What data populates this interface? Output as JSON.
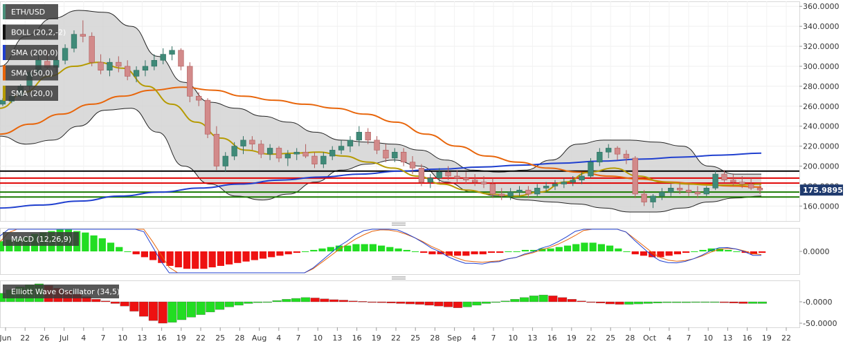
{
  "chart_data": [
    {
      "type": "line",
      "title": "ETH/USD",
      "legend": [
        {
          "label": "ETH/USD",
          "color": "#4a8f7a"
        },
        {
          "label": "BOLL (20,2,-2)",
          "color": "#111111"
        },
        {
          "label": "SMA (200,0)",
          "color": "#1f3fcf"
        },
        {
          "label": "SMA (50,0)",
          "color": "#e8650a"
        },
        {
          "label": "SMA (20,0)",
          "color": "#b59a00"
        }
      ],
      "ylim": [
        145,
        365
      ],
      "y_ticks": [
        "360.0000",
        "340.0000",
        "320.0000",
        "300.0000",
        "280.0000",
        "260.0000",
        "240.0000",
        "220.0000",
        "200.0000",
        "180.0000",
        "160.0000"
      ],
      "last_price": "175.98956",
      "x_ticks": [
        "Jun",
        "22",
        "26",
        "Jul",
        "4",
        "7",
        "10",
        "13",
        "16",
        "19",
        "22",
        "25",
        "28",
        "Aug",
        "4",
        "7",
        "10",
        "13",
        "16",
        "19",
        "22",
        "25",
        "28",
        "Sep",
        "4",
        "7",
        "10",
        "13",
        "16",
        "19",
        "22",
        "25",
        "28",
        "Oct",
        "4",
        "7",
        "10",
        "13",
        "16",
        "19",
        "22"
      ],
      "horizontal_levels": [
        {
          "value": 195,
          "color": "#000000"
        },
        {
          "value": 188,
          "color": "#e00000"
        },
        {
          "value": 183,
          "color": "#e00000"
        },
        {
          "value": 174,
          "color": "#1a7a00"
        },
        {
          "value": 169,
          "color": "#1a7a00"
        }
      ],
      "candles": [
        [
          262,
          268,
          260,
          266
        ],
        [
          265,
          272,
          263,
          270
        ],
        [
          270,
          282,
          268,
          280
        ],
        [
          280,
          296,
          276,
          294
        ],
        [
          294,
          312,
          290,
          306
        ],
        [
          305,
          316,
          296,
          299
        ],
        [
          299,
          310,
          294,
          306
        ],
        [
          306,
          322,
          302,
          318
        ],
        [
          318,
          336,
          314,
          332
        ],
        [
          332,
          346,
          324,
          330
        ],
        [
          330,
          334,
          300,
          304
        ],
        [
          304,
          312,
          292,
          296
        ],
        [
          296,
          308,
          290,
          304
        ],
        [
          304,
          310,
          294,
          300
        ],
        [
          300,
          306,
          286,
          290
        ],
        [
          290,
          300,
          284,
          296
        ],
        [
          296,
          306,
          290,
          300
        ],
        [
          300,
          312,
          296,
          306
        ],
        [
          306,
          318,
          302,
          312
        ],
        [
          312,
          320,
          306,
          316
        ],
        [
          316,
          318,
          296,
          300
        ],
        [
          300,
          304,
          264,
          270
        ],
        [
          270,
          274,
          260,
          266
        ],
        [
          266,
          268,
          228,
          232
        ],
        [
          232,
          240,
          196,
          200
        ],
        [
          200,
          214,
          194,
          210
        ],
        [
          210,
          224,
          206,
          220
        ],
        [
          220,
          230,
          212,
          226
        ],
        [
          226,
          230,
          216,
          222
        ],
        [
          222,
          226,
          208,
          212
        ],
        [
          212,
          222,
          206,
          218
        ],
        [
          218,
          220,
          204,
          208
        ],
        [
          208,
          216,
          200,
          212
        ],
        [
          212,
          218,
          206,
          214
        ],
        [
          214,
          222,
          208,
          210
        ],
        [
          210,
          214,
          198,
          202
        ],
        [
          202,
          214,
          198,
          210
        ],
        [
          210,
          220,
          206,
          216
        ],
        [
          216,
          226,
          212,
          220
        ],
        [
          220,
          230,
          214,
          226
        ],
        [
          226,
          240,
          220,
          234
        ],
        [
          234,
          238,
          222,
          226
        ],
        [
          226,
          230,
          212,
          216
        ],
        [
          216,
          222,
          204,
          208
        ],
        [
          208,
          218,
          204,
          214
        ],
        [
          214,
          218,
          200,
          204
        ],
        [
          204,
          210,
          192,
          198
        ],
        [
          198,
          202,
          180,
          184
        ],
        [
          184,
          192,
          178,
          188
        ],
        [
          188,
          198,
          184,
          194
        ],
        [
          194,
          200,
          186,
          190
        ],
        [
          190,
          196,
          184,
          188
        ],
        [
          188,
          194,
          182,
          186
        ],
        [
          186,
          192,
          180,
          184
        ],
        [
          184,
          190,
          178,
          182
        ],
        [
          182,
          188,
          168,
          172
        ],
        [
          172,
          178,
          166,
          170
        ],
        [
          170,
          178,
          166,
          174
        ],
        [
          174,
          180,
          170,
          176
        ],
        [
          176,
          180,
          168,
          172
        ],
        [
          172,
          182,
          170,
          178
        ],
        [
          178,
          184,
          174,
          180
        ],
        [
          180,
          186,
          176,
          182
        ],
        [
          182,
          188,
          178,
          184
        ],
        [
          184,
          190,
          180,
          186
        ],
        [
          186,
          194,
          182,
          190
        ],
        [
          190,
          208,
          188,
          204
        ],
        [
          204,
          218,
          200,
          214
        ],
        [
          214,
          222,
          208,
          218
        ],
        [
          218,
          220,
          206,
          212
        ],
        [
          212,
          216,
          202,
          208
        ],
        [
          208,
          210,
          168,
          172
        ],
        [
          172,
          176,
          160,
          164
        ],
        [
          164,
          172,
          158,
          170
        ],
        [
          170,
          178,
          166,
          174
        ],
        [
          174,
          182,
          170,
          178
        ],
        [
          178,
          184,
          172,
          176
        ],
        [
          176,
          182,
          170,
          174
        ],
        [
          174,
          180,
          168,
          172
        ],
        [
          172,
          180,
          170,
          178
        ],
        [
          178,
          196,
          176,
          192
        ],
        [
          192,
          196,
          184,
          186
        ],
        [
          186,
          192,
          180,
          184
        ],
        [
          184,
          190,
          178,
          182
        ],
        [
          182,
          188,
          176,
          178
        ],
        [
          178,
          182,
          172,
          176
        ]
      ],
      "series": [
        {
          "name": "SMA (200,0)",
          "values": [
            158,
            161,
            165,
            170,
            174,
            178,
            182,
            186,
            189,
            192,
            195,
            197,
            199,
            201,
            203,
            205,
            207,
            209,
            211,
            213
          ]
        },
        {
          "name": "SMA (50,0)",
          "values": [
            232,
            242,
            252,
            262,
            270,
            276,
            279,
            276,
            270,
            266,
            262,
            258,
            252,
            244,
            232,
            220,
            210,
            204,
            198,
            194,
            190,
            187,
            184,
            182,
            180,
            179
          ]
        },
        {
          "name": "SMA (20,0)",
          "values": [
            258,
            274,
            290,
            300,
            304,
            298,
            280,
            262,
            244,
            228,
            216,
            212,
            213,
            214,
            210,
            204,
            198,
            190,
            182,
            176,
            172,
            170,
            174,
            184,
            194,
            198,
            190,
            184,
            182,
            181,
            181,
            182
          ]
        },
        {
          "name": "BOLL upper",
          "values": [
            300,
            330,
            348,
            356,
            354,
            340,
            310,
            284,
            264,
            258,
            250,
            244,
            234,
            226,
            224,
            222,
            216,
            206,
            196,
            194,
            196,
            206,
            222,
            226,
            226,
            224,
            220,
            200,
            192,
            192
          ]
        },
        {
          "name": "BOLL lower",
          "values": [
            230,
            222,
            226,
            240,
            256,
            258,
            234,
            200,
            182,
            170,
            166,
            172,
            184,
            196,
            202,
            206,
            200,
            184,
            174,
            170,
            166,
            164,
            162,
            158,
            154,
            154,
            158,
            164,
            168,
            170
          ]
        }
      ]
    },
    {
      "type": "bar",
      "title": "MACD (12,26,9)",
      "y_ticks": [
        "0.0000"
      ],
      "values": [
        7,
        8,
        9,
        10,
        12,
        13,
        14,
        15,
        15,
        14,
        13,
        11,
        9,
        6,
        3,
        0,
        -2,
        -4,
        -6,
        -8,
        -10,
        -11,
        -12,
        -12,
        -12,
        -11,
        -10,
        -9,
        -8,
        -7,
        -6,
        -5,
        -4,
        -3,
        -2,
        -1,
        0,
        1,
        2,
        3,
        4,
        4,
        5,
        5,
        5,
        4,
        3,
        2,
        1,
        0,
        -1,
        -2,
        -2,
        -3,
        -3,
        -3,
        -2,
        -2,
        -1,
        -1,
        0,
        0,
        1,
        1,
        2,
        2,
        3,
        4,
        5,
        6,
        6,
        5,
        4,
        2,
        0,
        -2,
        -3,
        -4,
        -4,
        -3,
        -2,
        -1,
        0,
        1,
        2,
        2,
        1,
        0,
        -1,
        -2,
        -1
      ]
    },
    {
      "type": "bar",
      "title": "Elliott Wave Oscillator (34,5)",
      "y_ticks": [
        "-0.0000",
        "-50.0000"
      ],
      "values": [
        20,
        28,
        35,
        40,
        42,
        38,
        32,
        26,
        18,
        12,
        6,
        2,
        -4,
        -10,
        -22,
        -34,
        -44,
        -50,
        -48,
        -42,
        -36,
        -30,
        -24,
        -18,
        -12,
        -8,
        -4,
        -2,
        0,
        3,
        6,
        8,
        10,
        9,
        7,
        5,
        4,
        2,
        1,
        -1,
        -2,
        -3,
        -4,
        -5,
        -6,
        -8,
        -10,
        -12,
        -14,
        -12,
        -8,
        -4,
        -1,
        2,
        6,
        10,
        14,
        16,
        14,
        10,
        6,
        2,
        -1,
        -3,
        -5,
        -6,
        -6,
        -5,
        -4,
        -3,
        -2,
        -2,
        -2,
        -1,
        -1,
        -1,
        -2,
        -3,
        -4,
        -4,
        -4
      ]
    }
  ]
}
